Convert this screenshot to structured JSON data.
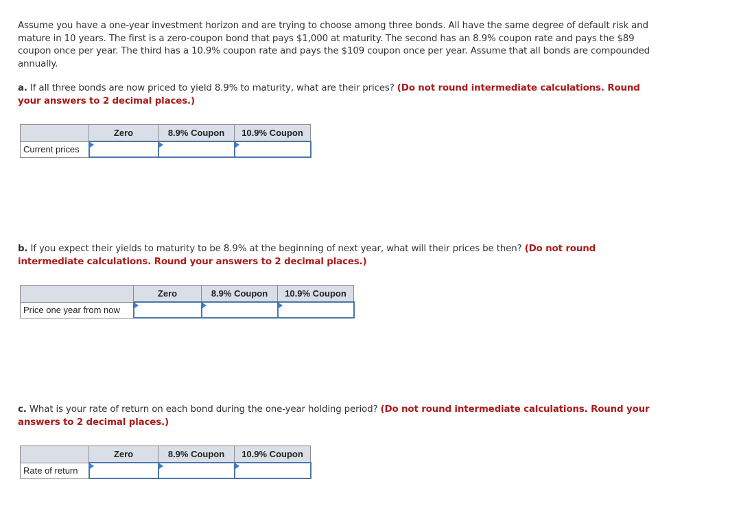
{
  "intro": {
    "text": "Assume you have a one-year investment horizon and are trying to choose among three bonds. All have the same degree of default risk and mature in 10 years. The first is a zero-coupon bond that pays $1,000 at maturity. The second has an 8.9% coupon rate and pays the $89 coupon once per year. The third has a 10.9% coupon rate and pays the $109 coupon once per year. Assume that all bonds are compounded annually."
  },
  "questions": {
    "a": {
      "letter": "a.",
      "text": " If all three bonds are now priced to yield 8.9% to maturity, what are their prices? ",
      "hint": "(Do not round intermediate calculations. Round your answers to 2 decimal places.)",
      "table": {
        "columns": [
          "",
          "Zero",
          "8.9% Coupon",
          "10.9% Coupon"
        ],
        "row_label": "Current prices",
        "values": [
          "",
          "",
          ""
        ]
      }
    },
    "b": {
      "letter": "b.",
      "text": " If you expect their yields to maturity to be 8.9% at the beginning of next year, what will their prices be then? ",
      "hint": "(Do not round intermediate calculations. Round your answers to 2 decimal places.)",
      "table": {
        "columns": [
          "",
          "Zero",
          "8.9% Coupon",
          "10.9% Coupon"
        ],
        "row_label": "Price one year from now",
        "values": [
          "",
          "",
          ""
        ]
      }
    },
    "c": {
      "letter": "c.",
      "text": " What is your rate of return on each bond during the one-year holding period? ",
      "hint": "(Do not round intermediate calculations. Round your answers to 2 decimal places.)",
      "table": {
        "columns": [
          "",
          "Zero",
          "8.9% Coupon",
          "10.9% Coupon"
        ],
        "row_label": "Rate of return",
        "values": [
          "",
          "",
          ""
        ]
      }
    }
  },
  "colors": {
    "hint_red": "#aa1b1b",
    "header_bg": "#d9dee7",
    "input_border": "#4a76a8",
    "flag_blue": "#3b7bd4"
  },
  "icons": {
    "input_flag": "entry-flag-icon"
  }
}
